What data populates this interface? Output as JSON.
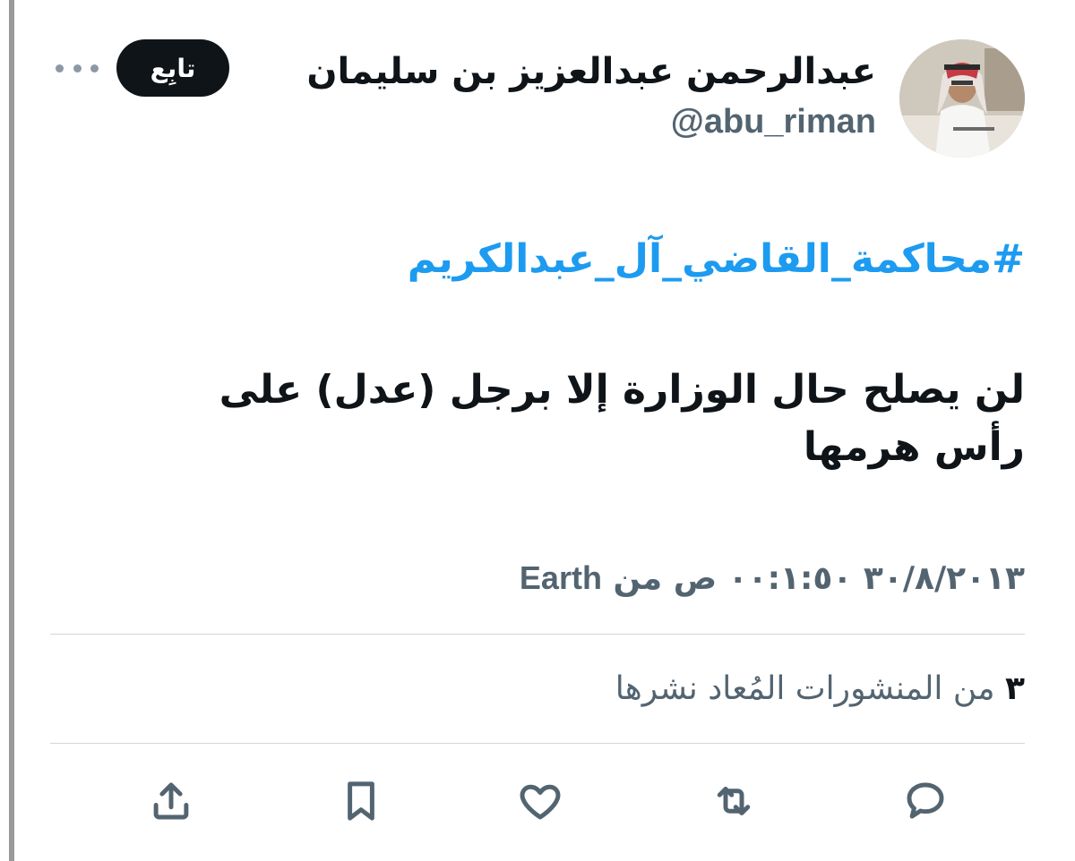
{
  "author": {
    "display_name": "عبدالرحمن عبدالعزيز بن سليمان",
    "handle": "@abu_riman"
  },
  "follow_label": "تابِع",
  "tweet": {
    "hashtag": "#محاكمة_القاضي_آل_عبدالكريم",
    "text": "لن يصلح حال الوزارة إلا برجل (عدل) على رأس هرمها"
  },
  "meta": {
    "datetime": "٣٠/٨/٢٠١٣ ٠٠:١:٥٠ ص",
    "from": "من",
    "source": "Earth"
  },
  "stats": {
    "count": "٣",
    "label": "من المنشورات المُعاد نشرها"
  },
  "icons": {
    "more": "more-horizontal-icon",
    "reply": "reply-icon",
    "retweet": "retweet-icon",
    "like": "heart-icon",
    "bookmark": "bookmark-icon",
    "share": "share-icon"
  },
  "colors": {
    "accent": "#1d9bf0",
    "text": "#0f1419",
    "secondary": "#536471",
    "follow_bg": "#0f1419"
  }
}
